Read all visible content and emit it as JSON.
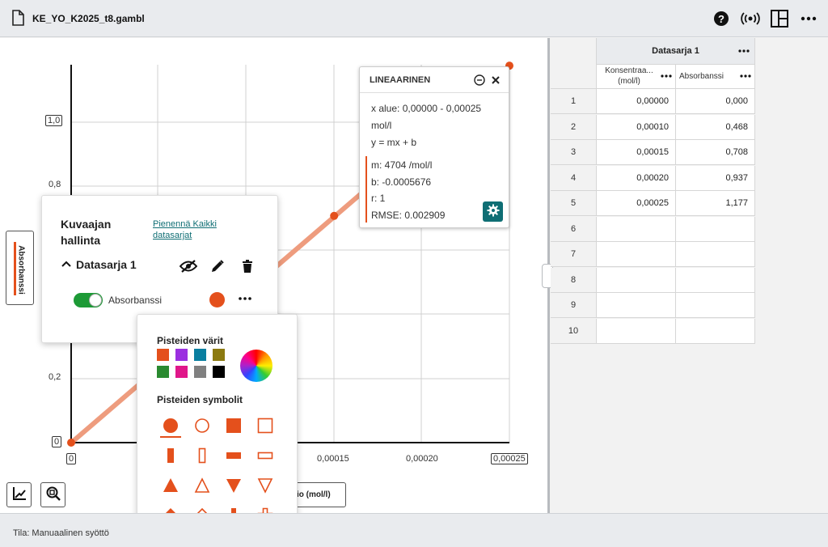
{
  "file": {
    "title": "KE_YO_K2025_t8.gambl"
  },
  "toolbar": {
    "icons": [
      "help-icon",
      "sensor-connect-icon",
      "layout-icon",
      "more-icon"
    ]
  },
  "graph": {
    "y_axis_label": "Absorbanssi",
    "x_axis_label": "io (mol/l)",
    "y_ticks": [
      "1,0",
      "0,8",
      "0,2",
      "0"
    ],
    "x_ticks": [
      "0",
      "0,00015",
      "0,00020",
      "0,00025"
    ]
  },
  "chart_data": {
    "type": "scatter",
    "x": [
      0.0,
      0.0001,
      0.00015,
      0.0002,
      0.00025
    ],
    "y": [
      0.0,
      0.468,
      0.708,
      0.937,
      1.177
    ],
    "xlim": [
      0,
      0.00025
    ],
    "ylim": [
      0,
      1.18
    ],
    "fit": {
      "m": 4704,
      "b": -0.0005676
    }
  },
  "linear_popup": {
    "title": "LINEAARINEN",
    "x_range": "x alue: 0,00000 - 0,00025",
    "x_unit": "mol/l",
    "equation": "y = mx + b",
    "m": "m: 4704 /mol/l",
    "b": "b: -0.0005676",
    "r": "r: 1",
    "rmse": "RMSE: 0.002909"
  },
  "graph_panel": {
    "title": "Kuvaajan hallinta",
    "collapse_link": "Pienennä Kaikki datasarjat",
    "dataset_name": "Datasarja 1",
    "series_label": "Absorbanssi",
    "series_color": "#e4501c"
  },
  "style_picker": {
    "colors_title": "Pisteiden värit",
    "symbols_title": "Pisteiden symbolit",
    "colors": [
      "#e4501c",
      "#9b30e0",
      "#0a7fa0",
      "#8c7a10",
      "#2a8a30",
      "#e0178a",
      "#808080",
      "#000000"
    ],
    "symbols": [
      "circle-filled",
      "circle-outline",
      "square-filled",
      "square-outline",
      "vbar-filled",
      "vbar-outline",
      "hbar-filled",
      "hbar-outline",
      "triangle-up-filled",
      "triangle-up-outline",
      "triangle-down-filled",
      "triangle-down-outline",
      "diamond-filled",
      "diamond-outline",
      "plus-filled",
      "plus-outline"
    ]
  },
  "table": {
    "dataset": "Datasarja 1",
    "col1": "Konsentraa... (mol/l)",
    "col2": "Absorbanssi",
    "rows": [
      {
        "n": "1",
        "x": "0,00000",
        "y": "0,000"
      },
      {
        "n": "2",
        "x": "0,00010",
        "y": "0,468"
      },
      {
        "n": "3",
        "x": "0,00015",
        "y": "0,708"
      },
      {
        "n": "4",
        "x": "0,00020",
        "y": "0,937"
      },
      {
        "n": "5",
        "x": "0,00025",
        "y": "1,177"
      },
      {
        "n": "6",
        "x": "",
        "y": ""
      },
      {
        "n": "7",
        "x": "",
        "y": ""
      },
      {
        "n": "8",
        "x": "",
        "y": ""
      },
      {
        "n": "9",
        "x": "",
        "y": ""
      },
      {
        "n": "10",
        "x": "",
        "y": ""
      }
    ]
  },
  "status": {
    "text": "Tila: Manuaalinen syöttö"
  }
}
